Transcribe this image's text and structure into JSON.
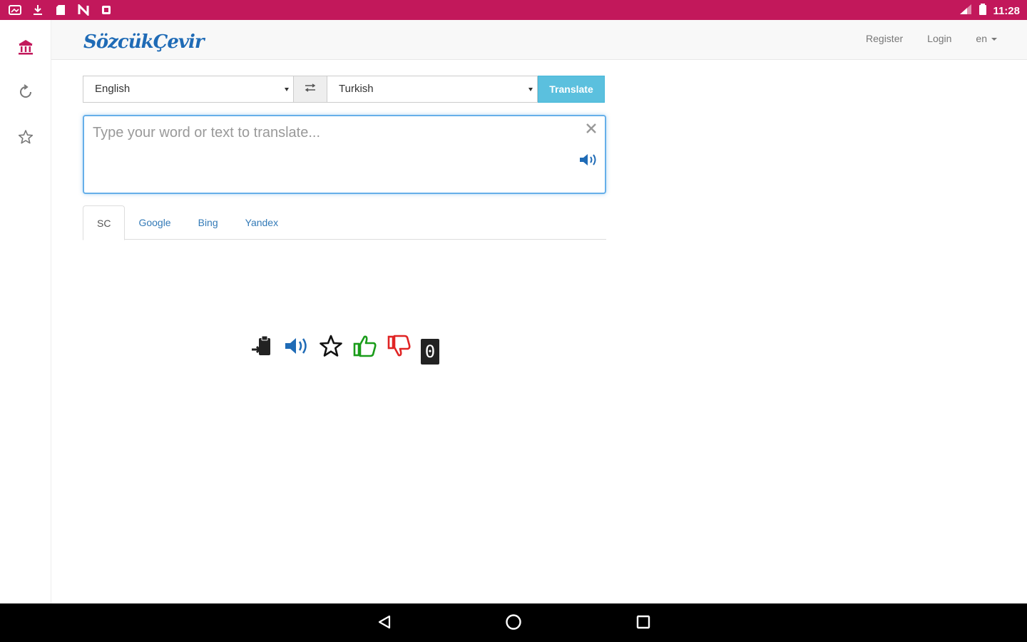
{
  "status_bar": {
    "time": "11:28",
    "colors": {
      "background": "#c2185b"
    }
  },
  "sidebar": {
    "items": [
      {
        "name": "institution-icon",
        "active": true
      },
      {
        "name": "history-icon"
      },
      {
        "name": "star-icon"
      }
    ]
  },
  "navbar": {
    "brand": "SözcükÇevir",
    "register": "Register",
    "login": "Login",
    "language": "en"
  },
  "translator": {
    "source_language": "English",
    "target_language": "Turkish",
    "translate_label": "Translate",
    "input_value": "",
    "input_placeholder": "Type your word or text to translate..."
  },
  "tabs": [
    {
      "label": "SC",
      "active": true
    },
    {
      "label": "Google"
    },
    {
      "label": "Bing"
    },
    {
      "label": "Yandex"
    }
  ],
  "result_actions": {
    "vote_count": "0",
    "colors": {
      "speaker": "#1f6bb6",
      "like": "#1a9c1a",
      "dislike": "#e02424"
    }
  }
}
